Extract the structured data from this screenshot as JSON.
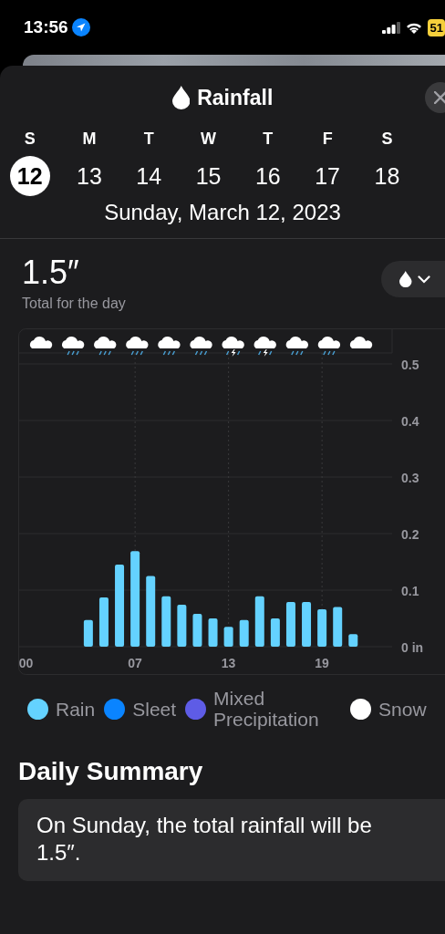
{
  "status_bar": {
    "time": "13:56",
    "battery": "51"
  },
  "sheet": {
    "title": "Rainfall"
  },
  "days": [
    {
      "letter": "S",
      "date": "12",
      "selected": true
    },
    {
      "letter": "M",
      "date": "13",
      "selected": false
    },
    {
      "letter": "T",
      "date": "14",
      "selected": false
    },
    {
      "letter": "W",
      "date": "15",
      "selected": false
    },
    {
      "letter": "T",
      "date": "16",
      "selected": false
    },
    {
      "letter": "F",
      "date": "17",
      "selected": false
    },
    {
      "letter": "S",
      "date": "18",
      "selected": false
    }
  ],
  "selected_date": "Sunday, March 12, 2023",
  "total": {
    "value": "1.5″",
    "caption": "Total for the day"
  },
  "conditions": [
    {
      "kind": "cloud"
    },
    {
      "kind": "rain"
    },
    {
      "kind": "rain"
    },
    {
      "kind": "rain"
    },
    {
      "kind": "rain"
    },
    {
      "kind": "rain"
    },
    {
      "kind": "thunder"
    },
    {
      "kind": "thunder"
    },
    {
      "kind": "rain"
    },
    {
      "kind": "rain"
    },
    {
      "kind": "cloud"
    }
  ],
  "chart_data": {
    "type": "bar",
    "x": [
      4,
      5,
      6,
      7,
      8,
      9,
      10,
      11,
      12,
      13,
      14,
      15,
      16,
      17,
      18,
      19,
      20,
      21
    ],
    "series": [
      {
        "name": "Rain",
        "color": "#64d2ff",
        "values": [
          0.047,
          0.087,
          0.145,
          0.169,
          0.125,
          0.089,
          0.074,
          0.058,
          0.05,
          0.035,
          0.047,
          0.089,
          0.05,
          0.079,
          0.079,
          0.066,
          0.07,
          0.022
        ]
      }
    ],
    "grid": true,
    "xticks": [
      {
        "value": 0,
        "label": "00"
      },
      {
        "value": 7,
        "label": "07"
      },
      {
        "value": 13,
        "label": "13"
      },
      {
        "value": 19,
        "label": "19"
      }
    ],
    "xlim": [
      -0.5,
      23.5
    ],
    "ylim": [
      0,
      0.5
    ],
    "yticks": [
      {
        "value": 0,
        "label": "0 in"
      },
      0.1,
      0.2,
      0.3,
      0.4,
      0.5
    ]
  },
  "legend": [
    {
      "label": "Sleet",
      "color": "#0a84ff"
    },
    {
      "label": "Mixed Precipitation",
      "color": "#5e5ce6"
    },
    {
      "label": "Snow",
      "color": "#ffffff"
    }
  ],
  "summary": {
    "heading": "Daily Summary",
    "text": "On Sunday, the total rainfall will be 1.5″."
  }
}
